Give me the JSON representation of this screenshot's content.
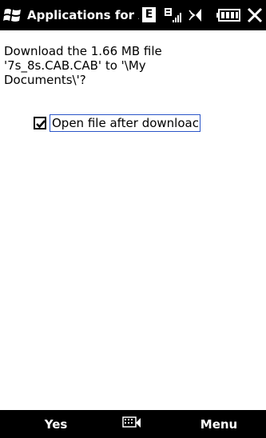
{
  "title_bar": {
    "app_title": "Applications for Ac",
    "network_badge": "E",
    "icons": [
      "windows-start-icon",
      "signal-strength-icon",
      "volume-icon",
      "battery-icon",
      "close-icon"
    ]
  },
  "dialog": {
    "message": "Download the 1.66 MB file '7s_8s.CAB.CAB' to '\\My Documents\\'?",
    "open_after_download": {
      "label": "Open file after downloac",
      "checked": true
    }
  },
  "soft_keys": {
    "left": "Yes",
    "right": "Menu",
    "center_icon": "keyboard-icon"
  },
  "colors": {
    "bar_background": "#000000",
    "content_background": "#ffffff",
    "focus_border": "#2a55c8"
  }
}
